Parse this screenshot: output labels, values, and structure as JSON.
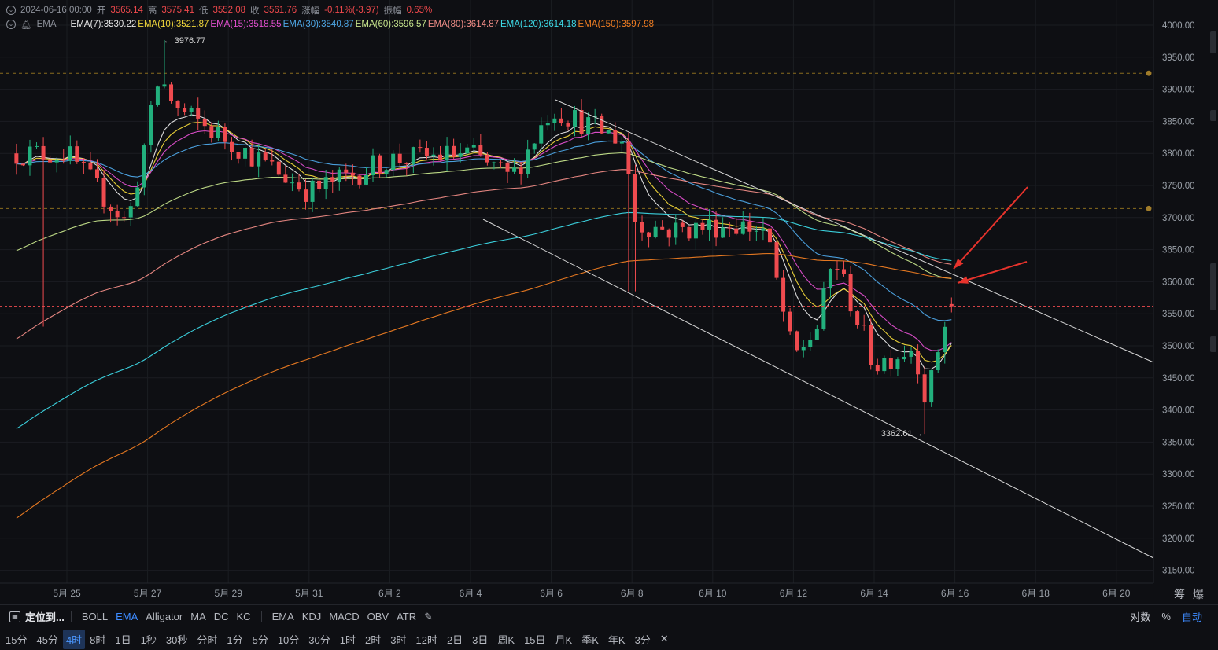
{
  "header": {
    "datetime": "2024-06-16 00:00",
    "open_label": "开",
    "open": "3565.14",
    "high_label": "高",
    "high": "3575.41",
    "low_label": "低",
    "low": "3552.08",
    "close_label": "收",
    "close": "3561.76",
    "change_label": "涨幅",
    "change": "-0.11%(-3.97)",
    "amp_label": "振幅",
    "amp": "0.65%",
    "indicator_name": "EMA",
    "emas": [
      {
        "label": "EMA(7):3530.22",
        "color": "#e8e8e8"
      },
      {
        "label": "EMA(10):3521.87",
        "color": "#f2d83a"
      },
      {
        "label": "EMA(15):3518.55",
        "color": "#e24fcf"
      },
      {
        "label": "EMA(30):3540.87",
        "color": "#4ea7e6"
      },
      {
        "label": "EMA(60):3596.57",
        "color": "#c6e48b"
      },
      {
        "label": "EMA(80):3614.87",
        "color": "#f08c86"
      },
      {
        "label": "EMA(120):3614.18",
        "color": "#3dd9e6"
      },
      {
        "label": "EMA(150):3597.98",
        "color": "#ef7d22"
      }
    ]
  },
  "chart_data": {
    "type": "candlestick",
    "symbol_interval": "4时",
    "y_ticks": [
      4000,
      3950,
      3900,
      3850,
      3800,
      3750,
      3700,
      3650,
      3600,
      3550,
      3500,
      3450,
      3400,
      3350,
      3300,
      3250,
      3200,
      3150
    ],
    "y_tick_labels": [
      "4000.00",
      "3950.00",
      "3900.00",
      "3850.00",
      "3800.00",
      "3750.00",
      "3700.00",
      "3650.00",
      "3600.00",
      "3550.00",
      "3500.00",
      "3450.00",
      "3400.00",
      "3350.00",
      "3300.00",
      "3250.00",
      "3200.00",
      "3150.00"
    ],
    "x_tick_labels": [
      "5月 25",
      "5月 27",
      "5月 29",
      "5月 31",
      "6月 2",
      "6月 4",
      "6月 6",
      "6月 8",
      "6月 10",
      "6月 12",
      "6月 14",
      "6月 16",
      "6月 18",
      "6月 20"
    ],
    "x_tick_day_offsets": [
      0,
      2,
      4,
      6,
      8,
      10,
      12,
      14,
      16,
      18,
      20,
      22,
      24,
      26
    ],
    "current_price_label": "3561.76",
    "current_price": 3561.76,
    "high_annotation": "3976.77",
    "low_annotation": "3362.61",
    "horizontal_levels": [
      3925,
      3714
    ],
    "key_points": [
      {
        "t": 0,
        "price": 3800
      },
      {
        "t": 1.5,
        "price": 3690
      },
      {
        "t": 2.3,
        "price": 3920
      },
      {
        "t": 2.7,
        "price": 3870
      },
      {
        "t": 4,
        "price": 3820
      },
      {
        "t": 6,
        "price": 3740
      },
      {
        "t": 8,
        "price": 3790
      },
      {
        "t": 10,
        "price": 3800
      },
      {
        "t": 11,
        "price": 3760
      },
      {
        "t": 12,
        "price": 3870
      },
      {
        "t": 13.8,
        "price": 3820
      },
      {
        "t": 14.1,
        "price": 3690
      },
      {
        "t": 15,
        "price": 3680
      },
      {
        "t": 16.5,
        "price": 3690
      },
      {
        "t": 17.3,
        "price": 3680
      },
      {
        "t": 18,
        "price": 3480
      },
      {
        "t": 18.6,
        "price": 3530
      },
      {
        "t": 19,
        "price": 3640
      },
      {
        "t": 20,
        "price": 3470
      },
      {
        "t": 21,
        "price": 3500
      },
      {
        "t": 21.3,
        "price": 3410
      },
      {
        "t": 21.7,
        "price": 3530
      },
      {
        "t": 22.0,
        "price": 3562
      }
    ]
  },
  "toolbar1": {
    "locate": "定位到...",
    "indicators": [
      "BOLL",
      "EMA",
      "Alligator",
      "MA",
      "DC",
      "KC"
    ],
    "sub_indicators": [
      "EMA",
      "KDJ",
      "MACD",
      "OBV",
      "ATR"
    ],
    "right": [
      "对数",
      "%",
      "自动"
    ]
  },
  "toolbar2": {
    "intervals": [
      "15分",
      "45分",
      "4时",
      "8时",
      "1日",
      "1秒",
      "30秒",
      "分时",
      "1分",
      "5分",
      "10分",
      "30分",
      "1时",
      "2时",
      "3时",
      "12时",
      "2日",
      "3日",
      "周K",
      "15日",
      "月K",
      "季K",
      "年K",
      "3分"
    ]
  },
  "corner": {
    "left": "筹",
    "right": "爆"
  },
  "colors": {
    "up": "#22b07d",
    "down": "#ef4b4f",
    "bg": "#0e0f13"
  }
}
